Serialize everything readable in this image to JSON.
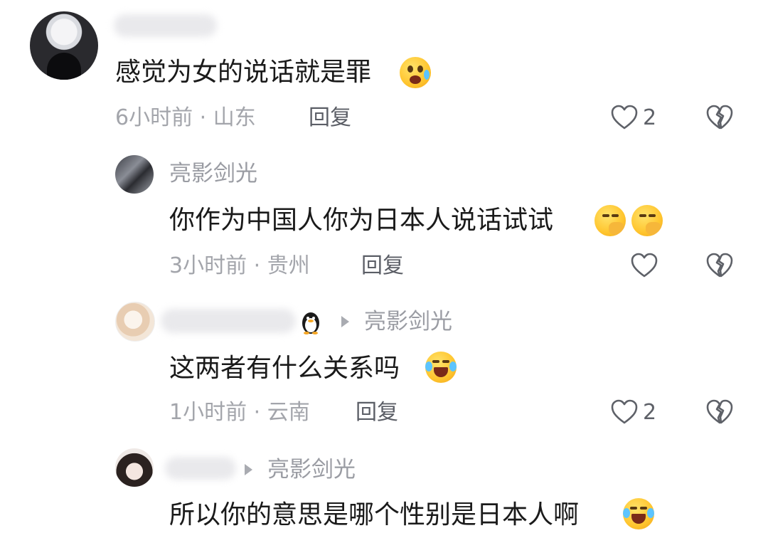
{
  "comments": [
    {
      "id": "c1",
      "name": "",
      "text": "感觉为女的说话就是罪",
      "emoji": [
        "fearful-crying-face"
      ],
      "time": "6小时前",
      "location": "山东",
      "reply_label": "回复",
      "likes": "2"
    },
    {
      "id": "c2",
      "name": "亮影剑光",
      "text": "你作为中国人你为日本人说话试试",
      "emoji": [
        "face-with-hand-over-mouth",
        "face-with-hand-over-mouth"
      ],
      "time": "3小时前",
      "location": "贵州",
      "reply_label": "回复",
      "likes": ""
    },
    {
      "id": "c3",
      "name": "",
      "reply_to": "亮影剑光",
      "text": "这两者有什么关系吗",
      "emoji": [
        "laughing-crying-face"
      ],
      "time": "1小时前",
      "location": "云南",
      "reply_label": "回复",
      "likes": "2"
    },
    {
      "id": "c4",
      "name": "",
      "reply_to": "亮影剑光",
      "text": "所以你的意思是哪个性别是日本人啊",
      "emoji": [
        "laughing-crying-face"
      ]
    }
  ],
  "separator": "·",
  "icons": {
    "like": "heart-outline-icon",
    "dislike": "broken-heart-icon",
    "reply_arrow": "triangle-right-icon",
    "badge": "penguin-icon"
  },
  "colors": {
    "text": "#1a1a1a",
    "meta": "#a3a5ab",
    "name": "#9a9ca3",
    "icon": "#5e6168"
  }
}
